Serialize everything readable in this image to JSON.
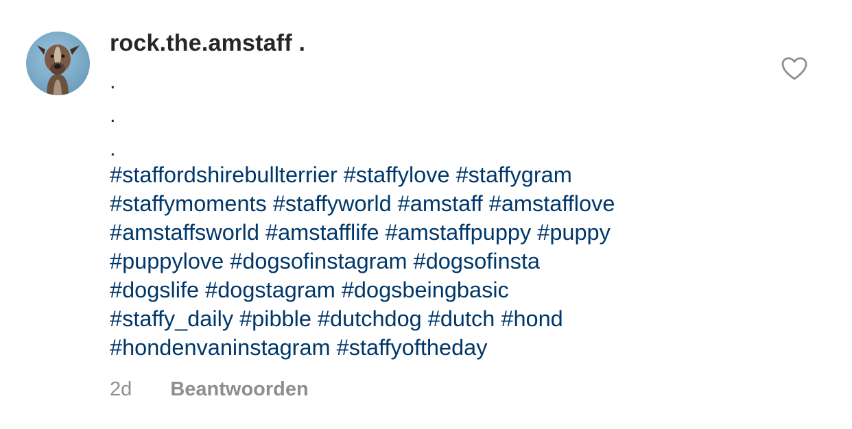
{
  "comment": {
    "username": "rock.the.amstaff .",
    "avatar_icon": "dog-avatar",
    "dot_lines": [
      ".",
      ".",
      "."
    ],
    "hashtag_lines": [
      "#staffordshirebullterrier #staffylove #staffygram",
      "#staffymoments #staffyworld #amstaff #amstafflove",
      "#amstaffsworld #amstafflife #amstaffpuppy #puppy",
      "#puppylove #dogsofinstagram #dogsofinsta",
      "#dogslife #dogstagram #dogsbeingbasic",
      "#staffy_daily #pibble #dutchdog #dutch #hond",
      "#hondenvaninstagram #staffyoftheday"
    ],
    "timestamp": "2d",
    "reply_label": "Beantwoorden",
    "like_icon": "heart-outline-icon"
  },
  "colors": {
    "username": "#262626",
    "hashtag": "#00376b",
    "meta": "#8e8e8e"
  }
}
